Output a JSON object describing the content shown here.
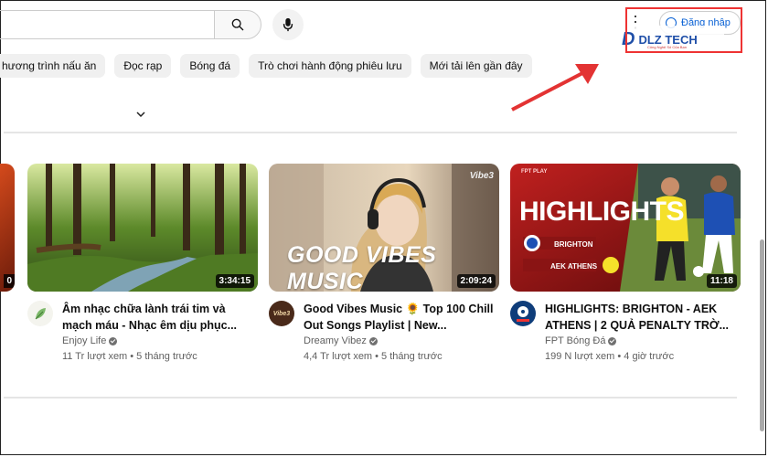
{
  "header": {
    "search": {
      "placeholder": ""
    },
    "more_icon": "⋮",
    "signin_label": "Đăng nhập",
    "logo_mark": "D",
    "logo_text": "DLZ TECH",
    "logo_sub": "Công Nghệ Số Của Bạn"
  },
  "chips": [
    "hương trình nấu ăn",
    "Đọc rạp",
    "Bóng đá",
    "Trò chơi hành động phiêu lưu",
    "Mới tải lên gần đây"
  ],
  "partial_video": {
    "duration": "0"
  },
  "videos": [
    {
      "duration": "3:34:15",
      "title": "Âm nhạc chữa lành trái tim và mạch máu - Nhạc êm dịu phục...",
      "channel": "Enjoy Life",
      "stats": "11 Tr lượt xem • 5 tháng trước",
      "thumb_overlay": ""
    },
    {
      "duration": "2:09:24",
      "title": "Good Vibes Music 🌻 Top 100 Chill Out Songs Playlist | New...",
      "channel": "Dreamy Vibez",
      "stats": "4,4 Tr lượt xem • 5 tháng trước",
      "thumb_overlay": "GOOD VIBES MUSIC",
      "thumb_logo": "Vibe3",
      "avatar_text": "Vibe3"
    },
    {
      "duration": "11:18",
      "title": "HIGHLIGHTS: BRIGHTON - AEK ATHENS | 2 QUẢ PENALTY TRỜ...",
      "channel": "FPT Bóng Đá",
      "stats": "199 N lượt xem • 4 giờ trước",
      "thumb_overlay": "HIGHLIGHTS",
      "team1": "BRIGHTON",
      "team2": "AEK ATHENS",
      "brand": "FPT PLAY"
    }
  ],
  "colors": {
    "accent": "#065fd4",
    "annotation": "#e33333",
    "fpt_red": "#b31c1c"
  }
}
